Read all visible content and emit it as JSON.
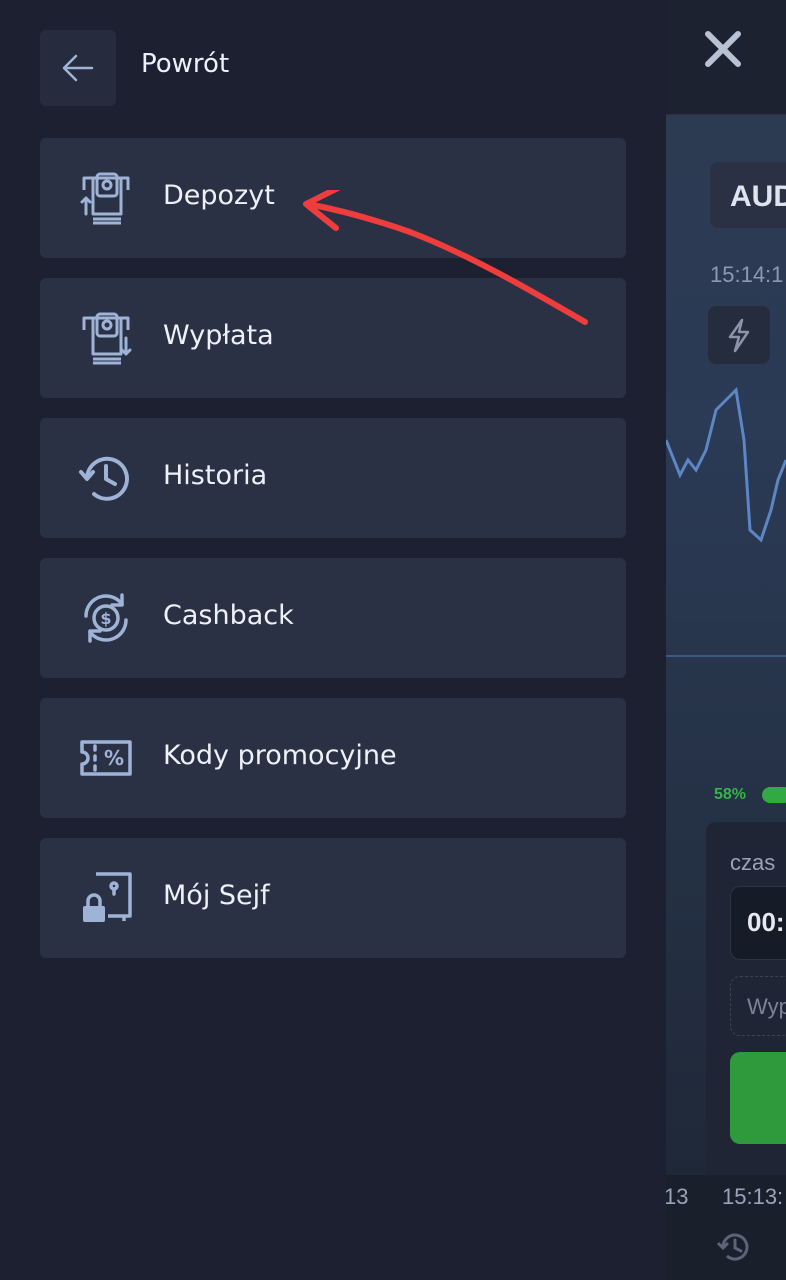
{
  "menu": {
    "back_label": "Powrót",
    "items": [
      {
        "label": "Depozyt",
        "icon": "deposit-atm-icon"
      },
      {
        "label": "Wypłata",
        "icon": "withdraw-atm-icon"
      },
      {
        "label": "Historia",
        "icon": "history-icon"
      },
      {
        "label": "Cashback",
        "icon": "cashback-icon"
      },
      {
        "label": "Kody promocyjne",
        "icon": "promo-code-icon"
      },
      {
        "label": "Mój Sejf",
        "icon": "safe-lock-icon"
      }
    ]
  },
  "background": {
    "asset": "AUD",
    "time": "15:14:1",
    "payout_percent": "58%",
    "time_label": "czas",
    "timer_value": "00:",
    "amount_placeholder": "Wyp",
    "axis_ticks": [
      "13",
      "15:13:"
    ]
  },
  "colors": {
    "drawer_bg": "#1d2030",
    "item_bg": "#2a3145",
    "icon_color": "#9eb3d6",
    "annotation_arrow": "#ef3c3c",
    "payout_green": "#37b349"
  }
}
